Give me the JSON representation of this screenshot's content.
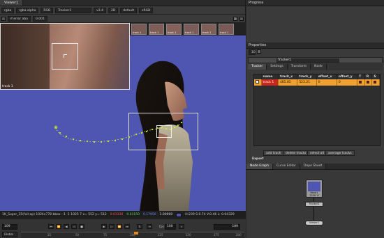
{
  "viewer": {
    "tab": "Viewer1",
    "toolbar1": {
      "channels": "rgba",
      "alpha": "rgba.alpha",
      "display": "RGB",
      "input_a": "Tracker1",
      "zoom": "v3.4",
      "mode": "2D",
      "lut_label": "default",
      "colorspace": "sRGB"
    },
    "toolbar2": {
      "gain_label": "if error abo",
      "gain_value": "0.001"
    },
    "overlay_label": "track 1",
    "thumb_labels": [
      "track 1",
      "track 1",
      "track 1",
      "track 1",
      "track 1",
      "track 1"
    ],
    "info_bar": {
      "format": "1K_Super_35(full-ap) 1024x778  bbox: -1 -1 1025 7  x= 552 y= 512",
      "r": "0.03330",
      "g": "0.03150",
      "b": "0.17950",
      "a": "1.00000",
      "hsv": "H:239 S:0.74 V:0.46  L: 0.04329"
    },
    "transport": {
      "frame": "109",
      "fps_label": "fps",
      "fps": "100",
      "end_frame": "189",
      "global_label": "Global",
      "ruler_ticks": [
        "25",
        "50",
        "75",
        "100",
        "125",
        "150",
        "175",
        "200"
      ]
    }
  },
  "progress": {
    "title": "Progress"
  },
  "properties": {
    "title": "Properties",
    "node_name": "Tracker1",
    "tabs": [
      "Tracker",
      "Settings",
      "Transform",
      "Node"
    ],
    "table_headers": [
      "",
      "name",
      "track_x",
      "track_y",
      "offset_x",
      "offset_y",
      "T",
      "R",
      "S"
    ],
    "rows": [
      [
        "",
        "track 1",
        "485.85",
        "523.21",
        "0",
        "0",
        "",
        "",
        ""
      ]
    ],
    "buttons": [
      "add track",
      "delete tracks",
      "select all",
      "average tracks"
    ],
    "export_label": "Export"
  },
  "node_graph": {
    "tabs": [
      "Node Graph",
      "Curve Editor",
      "Dope Sheet"
    ],
    "read_node": "Read1",
    "read_file": "2508.1f",
    "tracker_node": "Tracker1",
    "viewer_node": "Viewer1"
  },
  "colors": {
    "bluescreen": "#4f56b1",
    "track_point": "#c8f030",
    "row_highlight": "#f0a030",
    "accent": "#e38a1c"
  }
}
